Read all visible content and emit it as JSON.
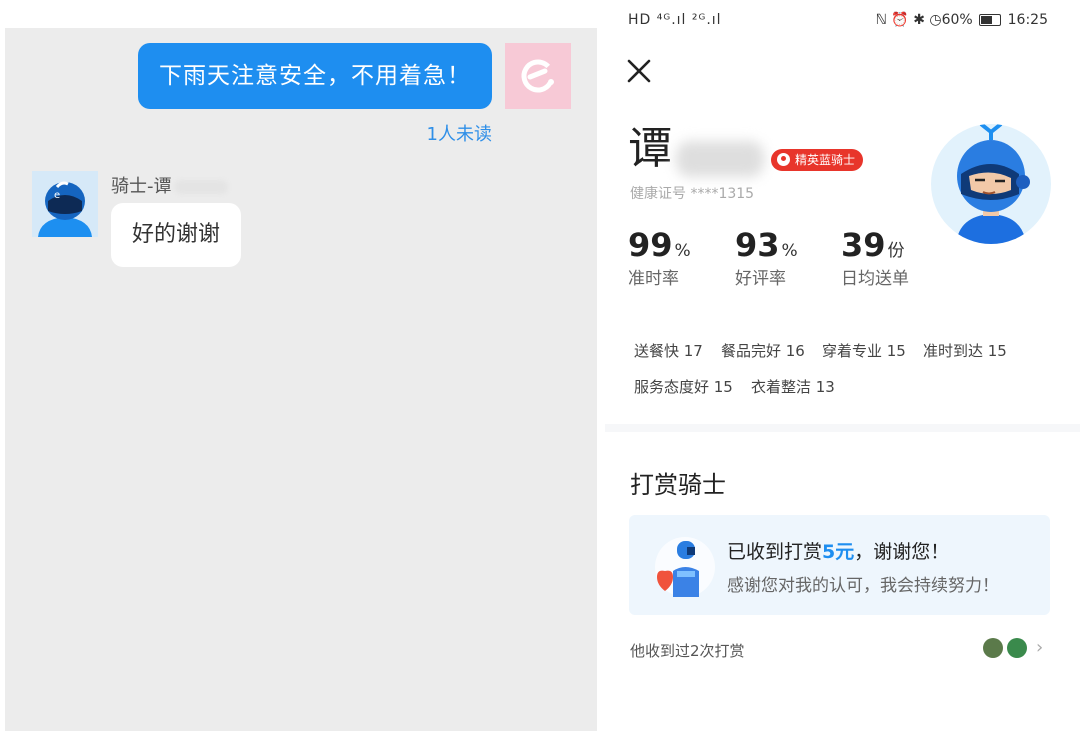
{
  "chat": {
    "outgoing_message": "下雨天注意安全，不用着急！",
    "unread_status": "1人未读",
    "rider_name_prefix": "骑士-谭",
    "incoming_message": "好的谢谢"
  },
  "status_bar": {
    "left_indicators": "HD ⁴ᴳ.ıl ²ᴳ.ıl",
    "right_indicators": "ℕ ⏰ ✱ ◷60%",
    "time": "16:25"
  },
  "profile": {
    "surname": "谭",
    "badge": "精英蓝骑士",
    "health_cert": "健康证号 ****1315",
    "stats": [
      {
        "value": "99",
        "unit": "%",
        "label": "准时率"
      },
      {
        "value": "93",
        "unit": "%",
        "label": "好评率"
      },
      {
        "value": "39",
        "unit": "份",
        "label": "日均送单"
      }
    ],
    "tags": [
      "送餐快 17",
      "餐品完好 16",
      "穿着专业 15",
      "准时到达 15",
      "服务态度好 15",
      "衣着整洁 13"
    ]
  },
  "tip": {
    "section_title": "打赏骑士",
    "received_prefix": "已收到打赏",
    "received_amount": "5元",
    "received_suffix": "，谢谢您！",
    "thanks_text": "感谢您对我的认可，我会持续努力！",
    "history": "他收到过2次打赏"
  },
  "colors": {
    "accent_blue": "#1e8ef0",
    "badge_red": "#e8352b",
    "chat_bg": "#ececec"
  }
}
